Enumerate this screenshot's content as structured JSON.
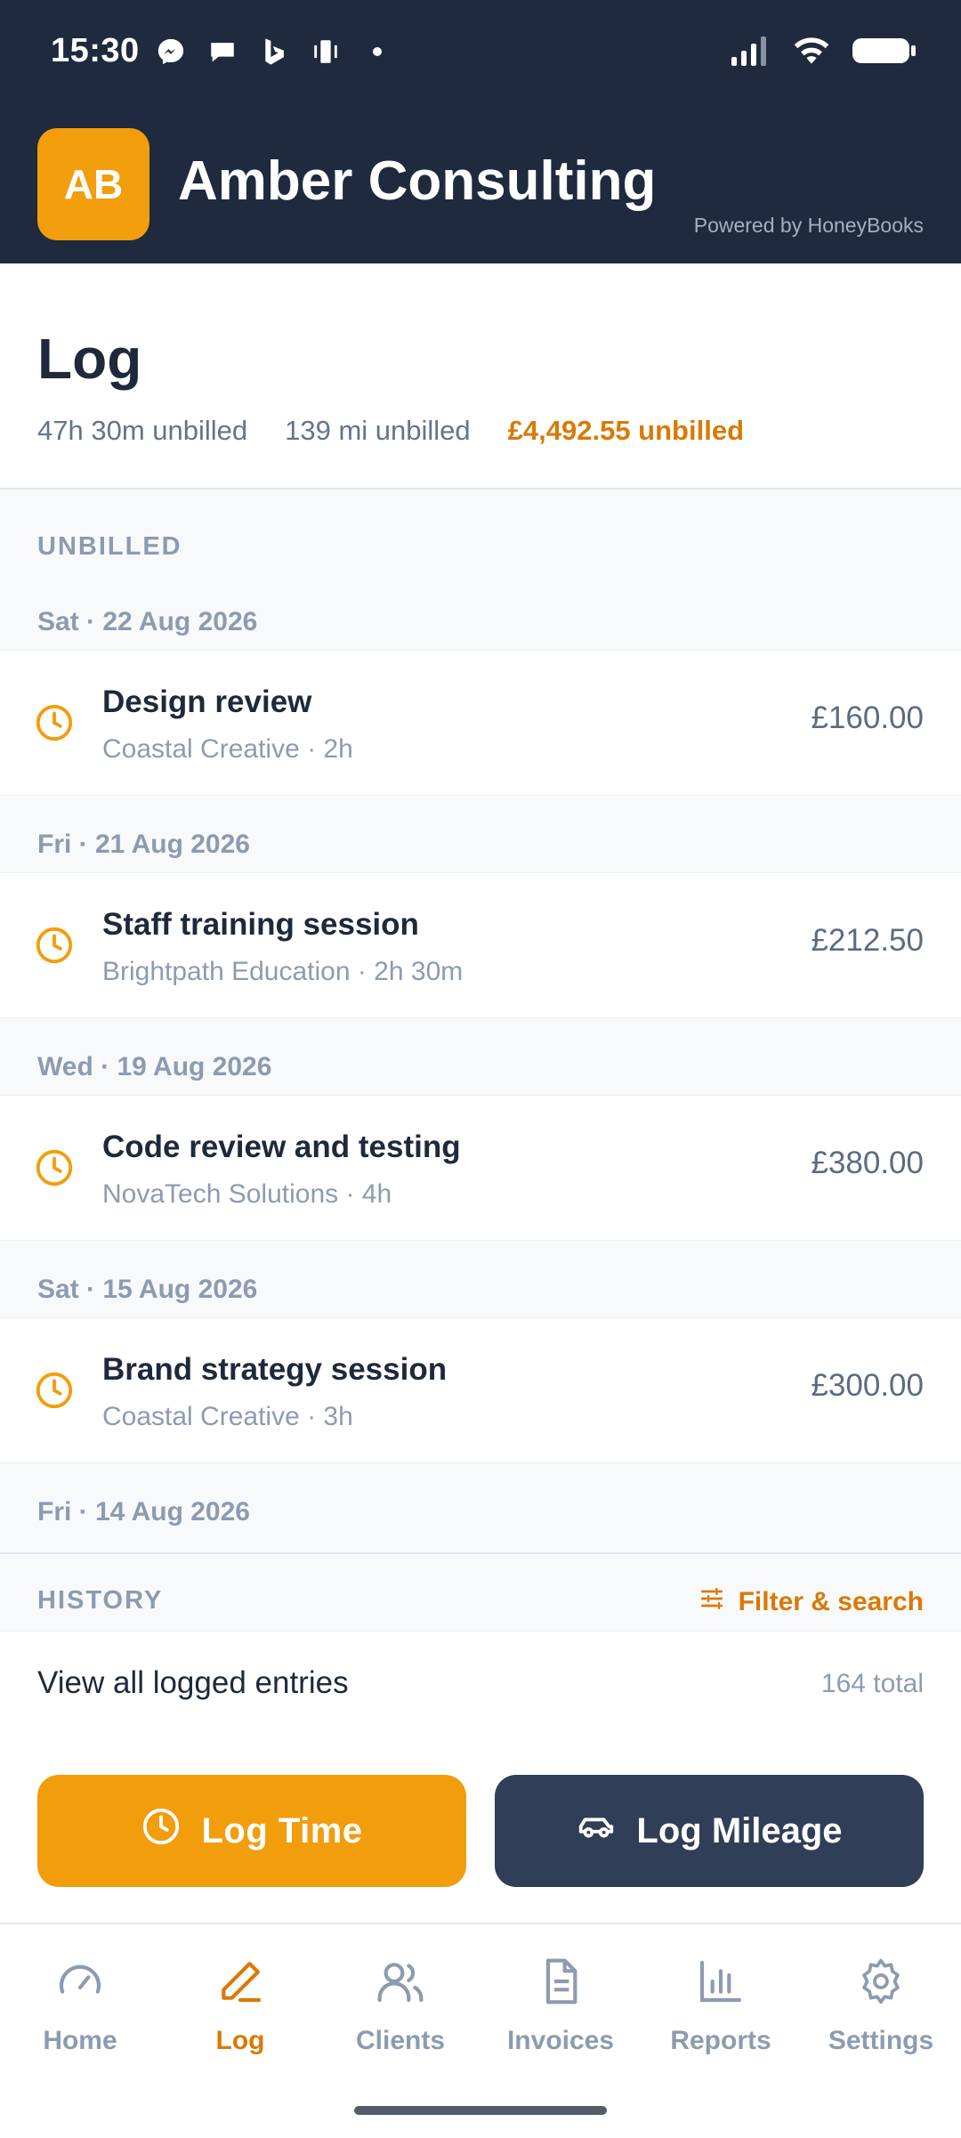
{
  "status_bar": {
    "time": "15:30"
  },
  "header": {
    "avatar_initials": "AB",
    "company": "Amber Consulting",
    "powered_by": "Powered by HoneyBooks"
  },
  "log": {
    "title": "Log",
    "stats": {
      "time": "47h 30m unbilled",
      "miles": "139 mi unbilled",
      "money": "£4,492.55 unbilled"
    }
  },
  "unbilled": {
    "label": "UNBILLED",
    "groups": [
      {
        "date": "Sat · 22 Aug 2026",
        "entry": {
          "title": "Design review",
          "sub": "Coastal Creative · 2h",
          "amount": "£160.00"
        }
      },
      {
        "date": "Fri · 21 Aug 2026",
        "entry": {
          "title": "Staff training session",
          "sub": "Brightpath Education · 2h 30m",
          "amount": "£212.50"
        }
      },
      {
        "date": "Wed · 19 Aug 2026",
        "entry": {
          "title": "Code review and testing",
          "sub": "NovaTech Solutions · 4h",
          "amount": "£380.00"
        }
      },
      {
        "date": "Sat · 15 Aug 2026",
        "entry": {
          "title": "Brand strategy session",
          "sub": "Coastal Creative · 3h",
          "amount": "£300.00"
        }
      },
      {
        "date": "Fri · 14 Aug 2026"
      }
    ]
  },
  "history": {
    "label": "HISTORY",
    "filter": "Filter & search",
    "view_all": "View all logged entries",
    "total": "164 total"
  },
  "actions": {
    "log_time": "Log Time",
    "log_mileage": "Log Mileage"
  },
  "nav": [
    "Home",
    "Log",
    "Clients",
    "Invoices",
    "Reports",
    "Settings"
  ],
  "colors": {
    "accent": "#f29d0c",
    "header_bg": "#1f2a3e",
    "secondary_btn": "#303f57"
  }
}
